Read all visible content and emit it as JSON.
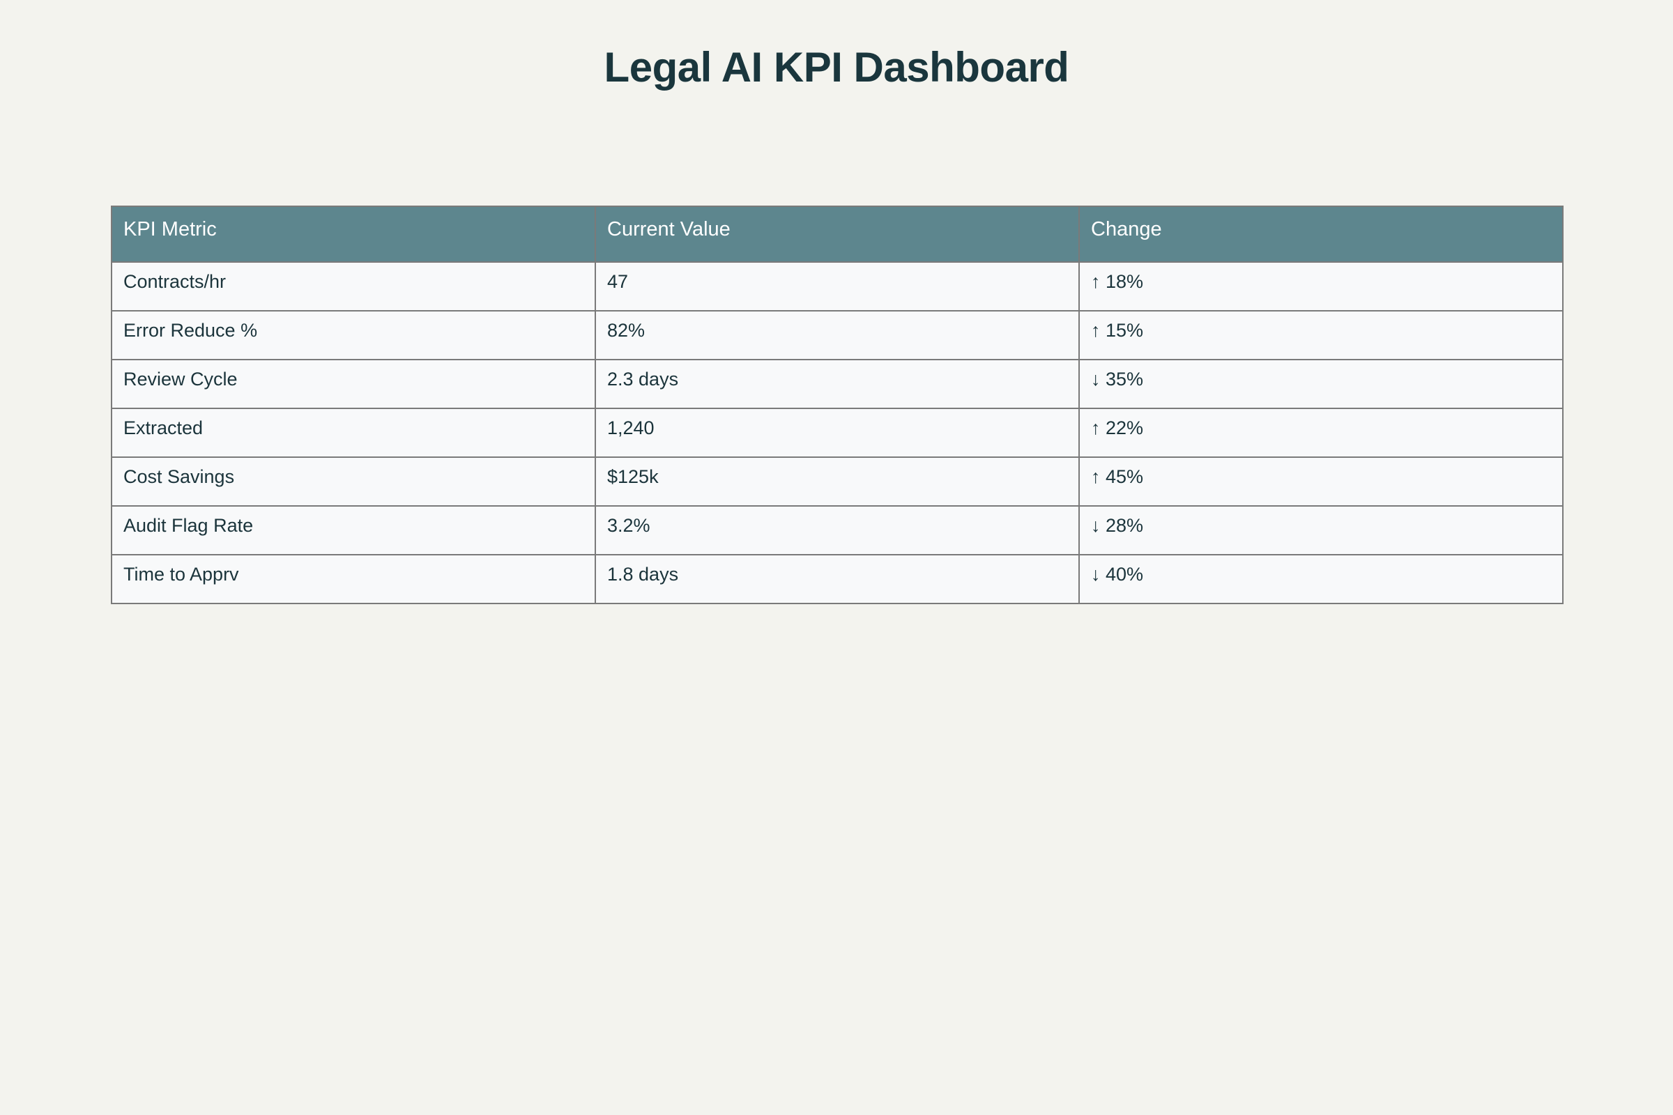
{
  "page": {
    "title": "Legal AI KPI Dashboard"
  },
  "colors": {
    "background": "#f3f3ee",
    "title": "#1a363d",
    "header_bg": "#5d868e",
    "header_text": "#ffffff",
    "cell_bg": "#f8f9fa",
    "cell_text": "#1b343b",
    "border": "#7a7a7a"
  },
  "chart_data": {
    "type": "table",
    "title": "Legal AI KPI Dashboard",
    "columns": [
      "KPI Metric",
      "Current Value",
      "Change"
    ],
    "rows": [
      [
        "Contracts/hr",
        "47",
        "↑ 18%"
      ],
      [
        "Error Reduce %",
        "82%",
        "↑ 15%"
      ],
      [
        "Review Cycle",
        "2.3 days",
        "↓ 35%"
      ],
      [
        "Extracted",
        "1,240",
        "↑ 22%"
      ],
      [
        "Cost Savings",
        "$125k",
        "↑ 45%"
      ],
      [
        "Audit Flag Rate",
        "3.2%",
        "↓ 28%"
      ],
      [
        "Time to Apprv",
        "1.8 days",
        "↓ 40%"
      ]
    ]
  }
}
